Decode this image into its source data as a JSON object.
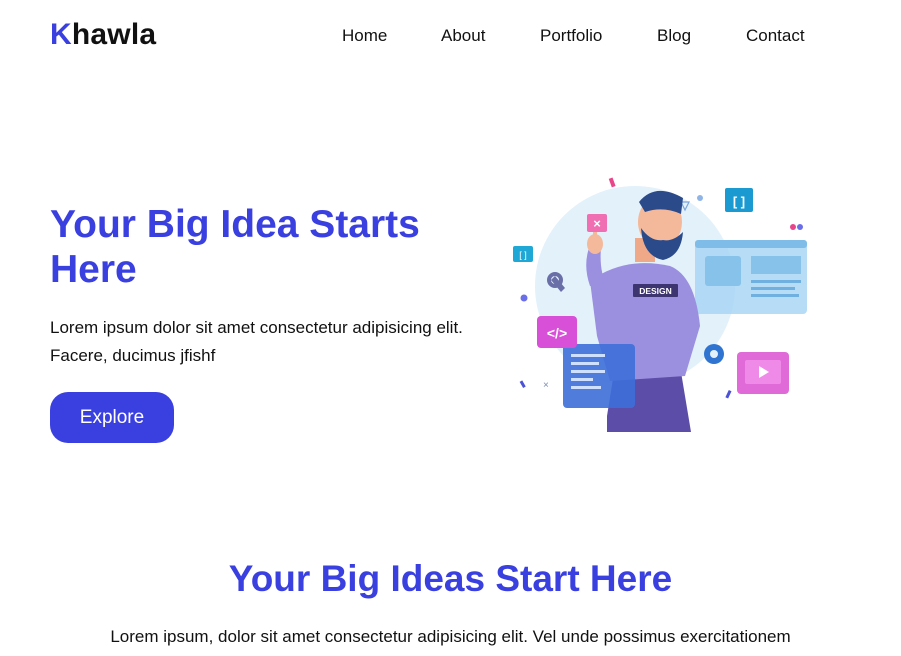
{
  "brand": {
    "first_letter": "K",
    "rest": "hawla"
  },
  "nav": {
    "items": [
      "Home",
      "About",
      "Portfolio",
      "Blog",
      "Contact"
    ]
  },
  "hero": {
    "title": "Your Big Idea Starts Here",
    "text": "Lorem ipsum dolor sit amet consectetur adipisicing elit. Facere, ducimus jfishf",
    "button_label": "Explore",
    "illustration": {
      "shirt_label": "DESIGN",
      "code_badge": "</>",
      "bracket_badge": "[ ]"
    }
  },
  "section": {
    "title": "Your Big Ideas Start Here",
    "text": "Lorem ipsum, dolor sit amet consectetur adipisicing elit. Vel unde possimus exercitationem"
  },
  "colors": {
    "accent": "#3a3fe0",
    "text": "#111111",
    "background": "#ffffff"
  }
}
